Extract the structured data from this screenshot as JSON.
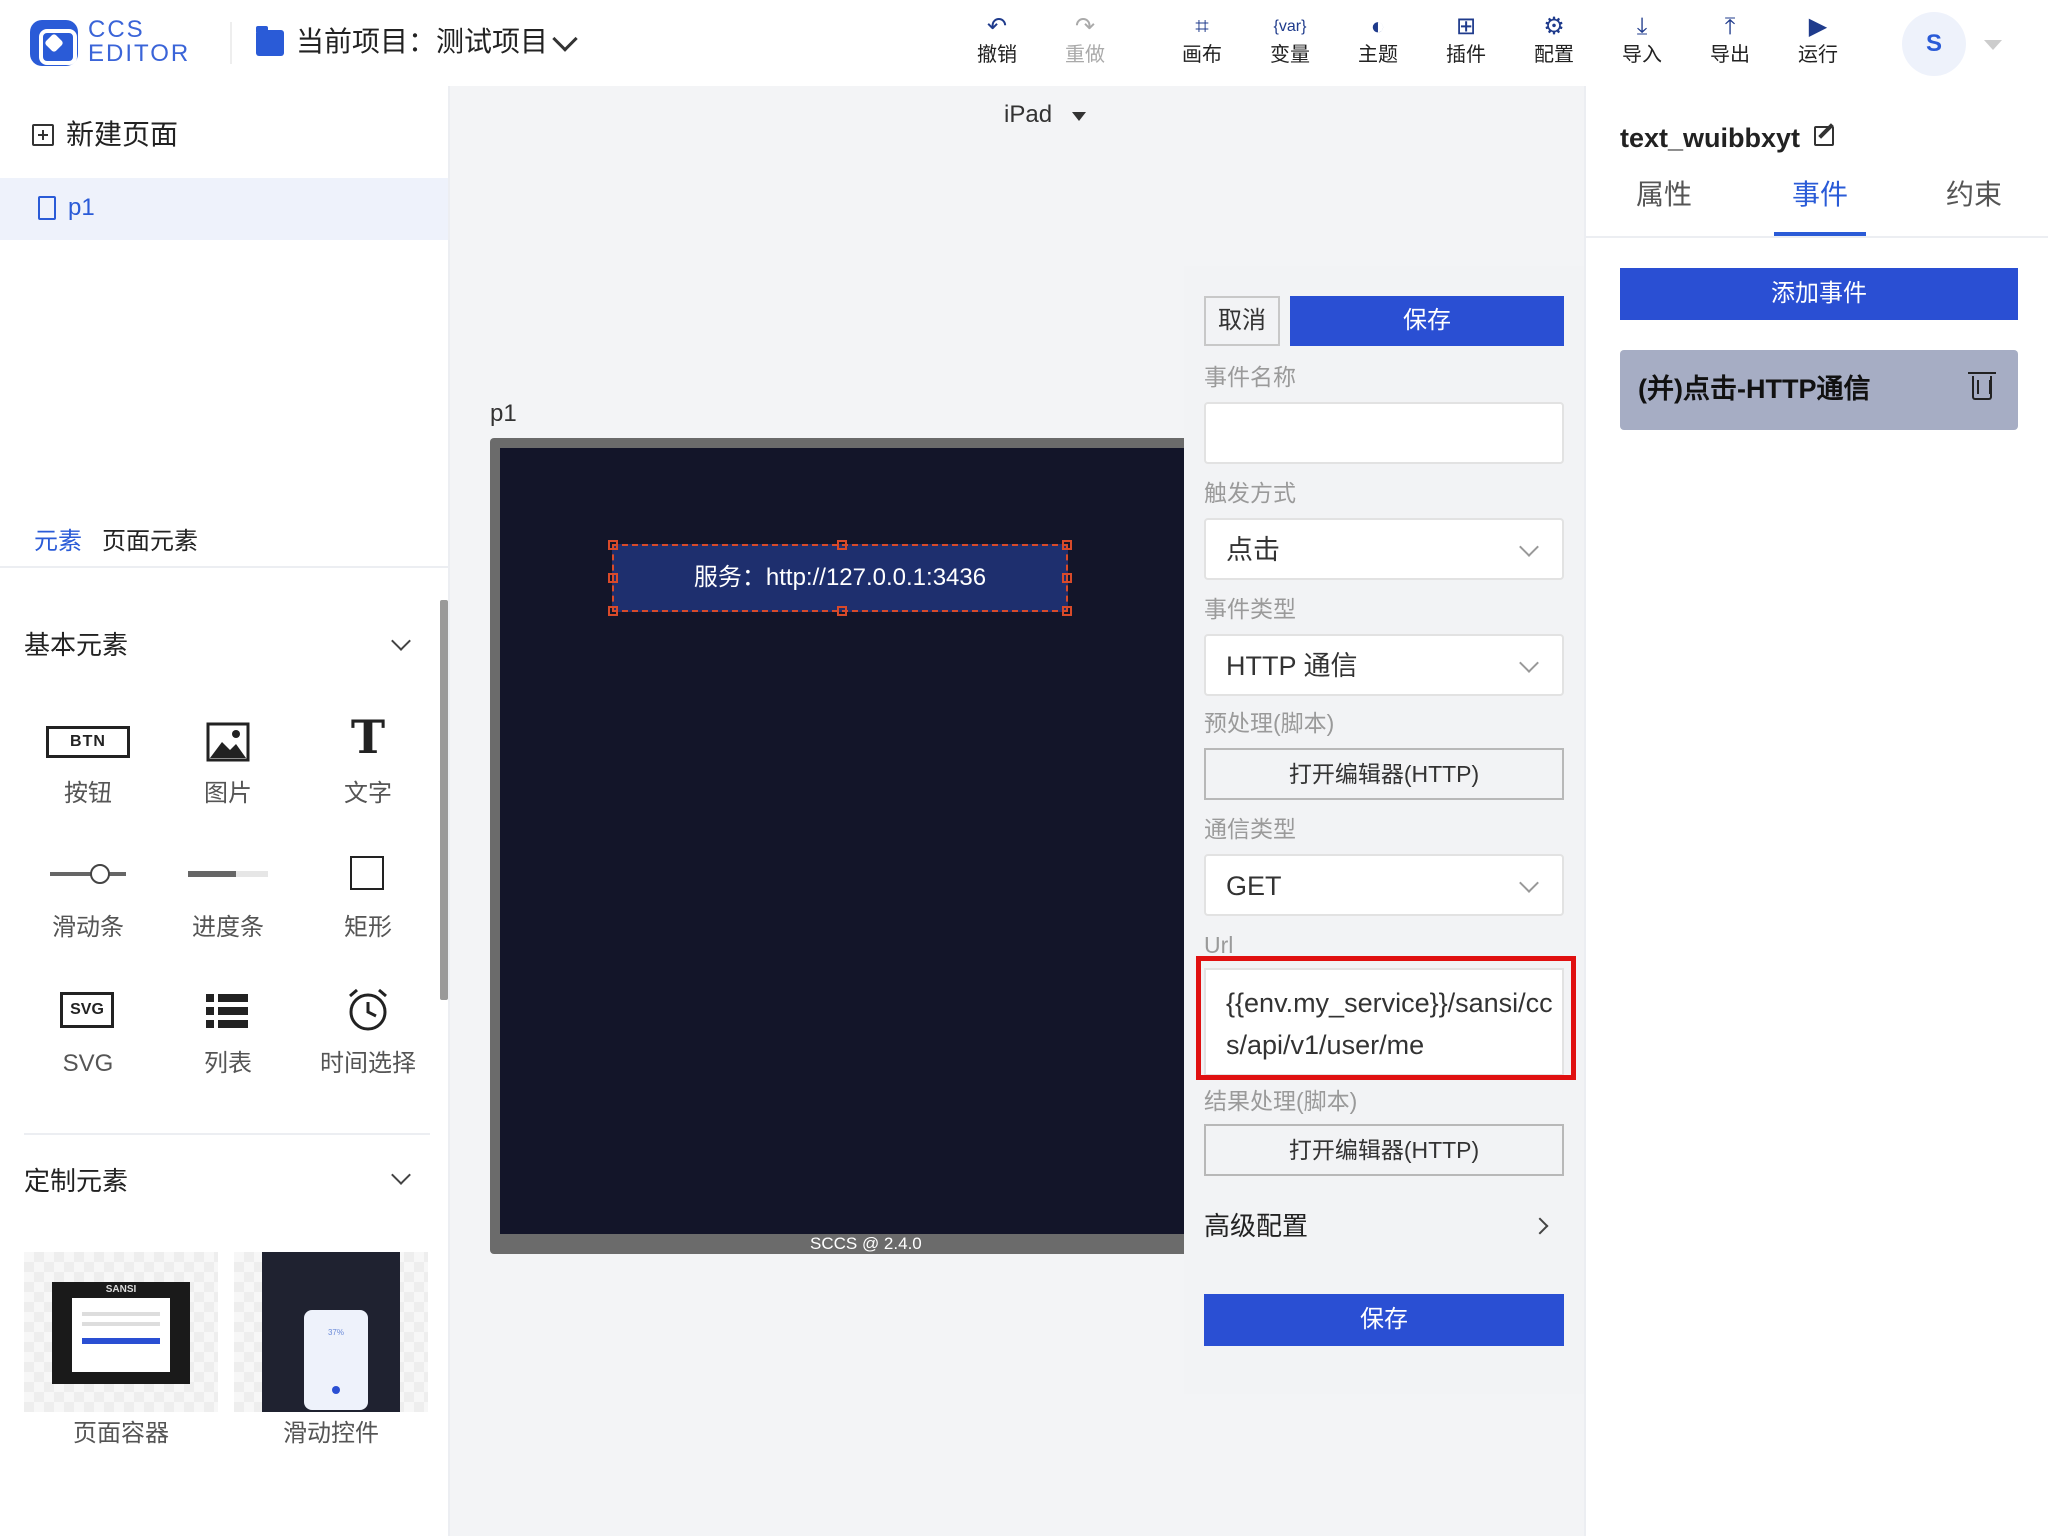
{
  "app": {
    "logo_line1": "CCS",
    "logo_line2": "EDITOR"
  },
  "header": {
    "project_title": "当前项目：测试项目",
    "toolbar": [
      {
        "icon": "undo-icon",
        "glyph": "↶",
        "label": "撤销",
        "enabled": true
      },
      {
        "icon": "redo-icon",
        "glyph": "↷",
        "label": "重做",
        "enabled": false
      },
      {
        "icon": "canvas-icon",
        "glyph": "⌗",
        "label": "画布",
        "enabled": true
      },
      {
        "icon": "variable-icon",
        "glyph": "{var}",
        "label": "变量",
        "enabled": true
      },
      {
        "icon": "theme-icon",
        "glyph": "◐",
        "label": "主题",
        "enabled": true
      },
      {
        "icon": "plugin-icon",
        "glyph": "⊞",
        "label": "插件",
        "enabled": true
      },
      {
        "icon": "settings-gear-icon",
        "glyph": "⚙",
        "label": "配置",
        "enabled": true
      },
      {
        "icon": "import-icon",
        "glyph": "⤓",
        "label": "导入",
        "enabled": true
      },
      {
        "icon": "export-icon",
        "glyph": "⤒",
        "label": "导出",
        "enabled": true
      },
      {
        "icon": "run-icon",
        "glyph": "▶",
        "label": "运行",
        "enabled": true
      }
    ],
    "avatar_initial": "S"
  },
  "sidebar": {
    "new_page_label": "新建页面",
    "pages": [
      {
        "label": "p1"
      }
    ],
    "tabs": [
      {
        "label": "元素",
        "active": true
      },
      {
        "label": "页面元素",
        "active": false
      }
    ],
    "basic_section_title": "基本元素",
    "basic_components": [
      {
        "icon": "button-icon",
        "label": "按钮",
        "badge": "BTN"
      },
      {
        "icon": "image-icon",
        "label": "图片"
      },
      {
        "icon": "text-icon",
        "label": "文字",
        "glyph": "T"
      },
      {
        "icon": "slider-icon",
        "label": "滑动条"
      },
      {
        "icon": "progress-bar-icon",
        "label": "进度条"
      },
      {
        "icon": "rectangle-icon",
        "label": "矩形"
      },
      {
        "icon": "svg-icon",
        "label": "SVG",
        "badge": "SVG"
      },
      {
        "icon": "list-icon",
        "label": "列表"
      },
      {
        "icon": "clock-icon",
        "label": "时间选择"
      }
    ],
    "custom_section_title": "定制元素",
    "custom_components": [
      {
        "label": "页面容器",
        "thumb_logo": "SANSI"
      },
      {
        "label": "滑动控件",
        "thumb_value": "37%"
      }
    ]
  },
  "canvas": {
    "device": "iPad",
    "page_name": "p1",
    "text_component_label": "服务：http://127.0.0.1:3436",
    "version": "SCCS @ 2.4.0"
  },
  "event_editor": {
    "cancel_label": "取消",
    "save_label": "保存",
    "fields": {
      "event_name": {
        "label": "事件名称",
        "value": ""
      },
      "trigger": {
        "label": "触发方式",
        "value": "点击"
      },
      "event_type": {
        "label": "事件类型",
        "value": "HTTP 通信"
      },
      "preprocess": {
        "label": "预处理(脚本)",
        "button": "打开编辑器(HTTP)"
      },
      "method": {
        "label": "通信类型",
        "value": "GET"
      },
      "url": {
        "label": "Url",
        "value": "{{env.my_service}}/sansi/ccs/api/v1/user/me"
      },
      "postprocess": {
        "label": "结果处理(脚本)",
        "button": "打开编辑器(HTTP)"
      }
    },
    "advanced_label": "高级配置",
    "save_bottom_label": "保存"
  },
  "inspector": {
    "component_name": "text_wuibbxyt",
    "tabs": [
      {
        "label": "属性",
        "active": false
      },
      {
        "label": "事件",
        "active": true
      },
      {
        "label": "约束",
        "active": false
      }
    ],
    "add_event_label": "添加事件",
    "events": [
      {
        "label": "(并)点击-HTTP通信"
      }
    ]
  },
  "colors": {
    "accent": "#2a4fd3",
    "highlight": "#e01010",
    "canvas_bg": "#131529"
  }
}
